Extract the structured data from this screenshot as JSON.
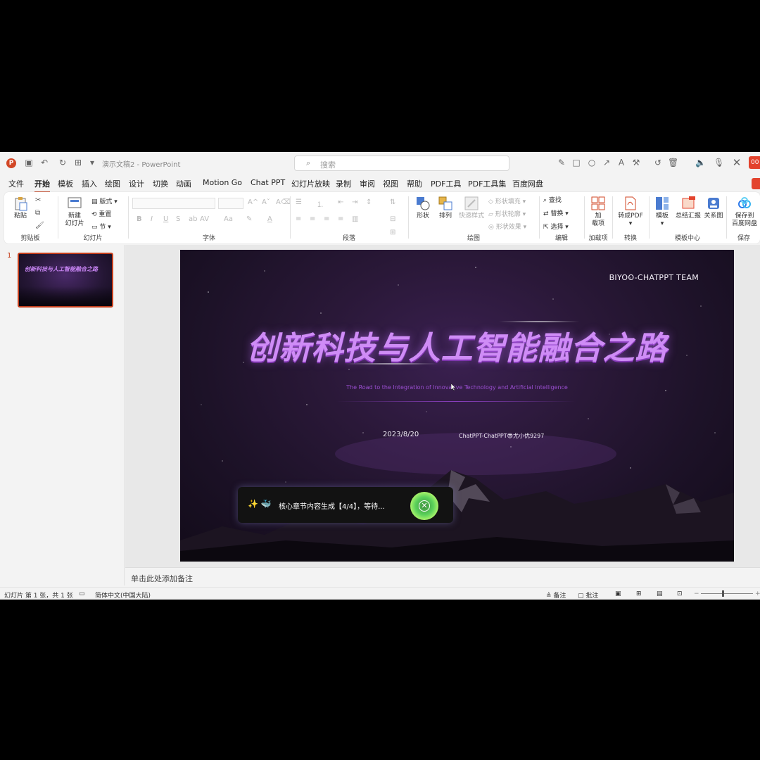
{
  "app": {
    "doc_title": "演示文稿2  -  PowerPoint",
    "search_placeholder": "搜索",
    "rec_badge": "00"
  },
  "tabs": [
    "文件",
    "开始",
    "模板",
    "插入",
    "绘图",
    "设计",
    "切换",
    "动画",
    "Motion Go",
    "Chat PPT",
    "幻灯片放映",
    "录制",
    "审阅",
    "视图",
    "帮助",
    "PDF工具",
    "PDF工具集",
    "百度网盘"
  ],
  "active_tab": "开始",
  "ribbon": {
    "clipboard": {
      "paste": "粘贴",
      "label": "剪贴板"
    },
    "slides": {
      "new_slide_1": "新建",
      "new_slide_2": "幻灯片",
      "layout": "版式",
      "reset": "重置",
      "section": "节",
      "label": "幻灯片"
    },
    "font": {
      "label": "字体"
    },
    "paragraph": {
      "label": "段落"
    },
    "drawing": {
      "shape": "形状",
      "arrange": "排列",
      "quick_styles": "快速样式",
      "fill": "形状填充",
      "outline": "形状轮廓",
      "effects": "形状效果",
      "label": "绘图"
    },
    "editing": {
      "find": "查找",
      "replace": "替换",
      "select": "选择",
      "label": "编辑"
    },
    "addins": {
      "btn_1": "加",
      "btn_2": "载项",
      "label": "加载项"
    },
    "convert": {
      "to_pdf": "转成PDF",
      "label": "转换"
    },
    "template_center": {
      "template": "模板",
      "summary": "总结汇报",
      "relation": "关系图",
      "label": "模板中心"
    },
    "save": {
      "btn_1": "保存到",
      "btn_2": "百度网盘",
      "label": "保存"
    }
  },
  "thumbnails": {
    "number": "1",
    "title": "创新科技与人工智能融合之路"
  },
  "slide": {
    "team": "BIYOO-CHATPPT TEAM",
    "title": "创新科技与人工智能融合之路",
    "subtitle": "The Road to the Integration of Innovative Technology and Artificial Intelligence",
    "date": "2023/8/20",
    "author": "ChatPPT-ChatPPT😎尤小优9297"
  },
  "toast": {
    "icons": "✨ 🐳",
    "text": "核心章节内容生成【4/4】，等待..."
  },
  "notes_placeholder": "单击此处添加备注",
  "status": {
    "slide_count": "幻灯片 第 1 张，共 1 张",
    "language": "简体中文(中国大陆)",
    "notes": "备注",
    "comments": "批注"
  }
}
